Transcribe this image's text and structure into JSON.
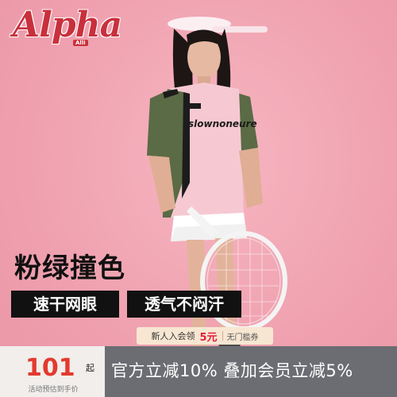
{
  "brand": {
    "name": "Alpha",
    "tag": "Alli",
    "color": "#c8303c"
  },
  "headline": "粉绿撞色",
  "tags": [
    "速干网眼",
    "透气不闷汗"
  ],
  "coupon": {
    "prefix": "新人入会领",
    "amount": "5元",
    "threshold": "无门槛券"
  },
  "price": {
    "value": "101",
    "suffix": "起",
    "note": "活动预估到手价"
  },
  "promo": "官方立减10% 叠加会员立减5%",
  "colors": {
    "background": "#f2a7b3",
    "price": "#e33a2e",
    "bottom_bar": "#6b6d73",
    "shirt_pink": "#f6c9d2",
    "shirt_green": "#5b6b45"
  }
}
